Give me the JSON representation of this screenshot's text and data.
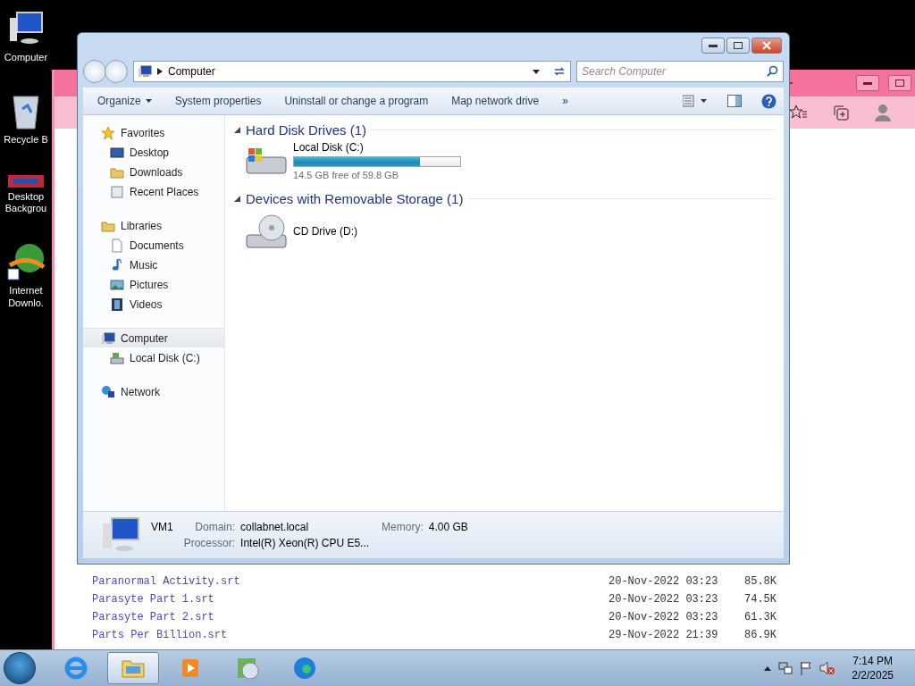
{
  "desktop_icons": [
    {
      "label": "Computer",
      "kind": "computer"
    },
    {
      "label": "Recycle B",
      "kind": "bin"
    },
    {
      "label": "Desktop Backgrou",
      "kind": "picture"
    },
    {
      "label": "Internet Downlo.",
      "kind": "globe"
    }
  ],
  "browser": {
    "files": [
      {
        "name": "Paranormal Activity.srt",
        "date": "20-Nov-2022 03:23",
        "size": "85.8K"
      },
      {
        "name": "Parasyte Part 1.srt",
        "date": "20-Nov-2022 03:23",
        "size": "74.5K"
      },
      {
        "name": "Parasyte Part 2.srt",
        "date": "20-Nov-2022 03:23",
        "size": "61.3K"
      },
      {
        "name": "Parts Per Billion.srt",
        "date": "29-Nov-2022 21:39",
        "size": "86.9K"
      }
    ]
  },
  "explorer": {
    "address": "Computer",
    "search": {
      "placeholder": "Search Computer"
    },
    "commands": [
      {
        "label": "Organize",
        "dropdown": true
      },
      {
        "label": "System properties",
        "dropdown": false
      },
      {
        "label": "Uninstall or change a program",
        "dropdown": false
      },
      {
        "label": "Map network drive",
        "dropdown": false
      },
      {
        "label": "»",
        "dropdown": false
      }
    ],
    "nav": [
      {
        "label": "Favorites",
        "kind": "star",
        "selected": false,
        "children": [
          {
            "label": "Desktop",
            "kind": "desktop",
            "selected": false
          },
          {
            "label": "Downloads",
            "kind": "folder",
            "selected": false
          },
          {
            "label": "Recent Places",
            "kind": "recent",
            "selected": false
          }
        ]
      },
      {
        "label": "Libraries",
        "kind": "folder",
        "selected": false,
        "children": [
          {
            "label": "Documents",
            "kind": "doc",
            "selected": false
          },
          {
            "label": "Music",
            "kind": "music",
            "selected": false
          },
          {
            "label": "Pictures",
            "kind": "picture",
            "selected": false
          },
          {
            "label": "Videos",
            "kind": "video",
            "selected": false
          }
        ]
      },
      {
        "label": "Computer",
        "kind": "computer",
        "selected": true,
        "children": [
          {
            "label": "Local Disk (C:)",
            "kind": "drive",
            "selected": false
          }
        ]
      },
      {
        "label": "Network",
        "kind": "network",
        "selected": false
      }
    ],
    "sections": [
      {
        "title": "Hard Disk Drives (1)",
        "drives": [
          {
            "name": "Local Disk (C:)",
            "kind": "hdd",
            "level": 0.76,
            "free": "14.5 GB free of 59.8 GB"
          }
        ]
      },
      {
        "title": "Devices with Removable Storage (1)",
        "drives": [
          {
            "name": "CD Drive (D:)",
            "kind": "cd"
          }
        ]
      }
    ],
    "details": {
      "name": "VM1",
      "fields": [
        {
          "label": "Domain:",
          "value": "collabnet.local"
        },
        {
          "label": "Memory:",
          "value": "4.00 GB"
        },
        {
          "label": "Processor:",
          "value": "Intel(R) Xeon(R) CPU E5..."
        }
      ]
    }
  },
  "taskbar": {
    "apps": [
      {
        "kind": "ie",
        "active": false
      },
      {
        "kind": "explorer",
        "active": true
      },
      {
        "kind": "media",
        "active": false
      },
      {
        "kind": "disc",
        "active": false
      },
      {
        "kind": "edge",
        "active": false
      }
    ],
    "time": "7:14 PM",
    "date": "2/2/2025"
  }
}
